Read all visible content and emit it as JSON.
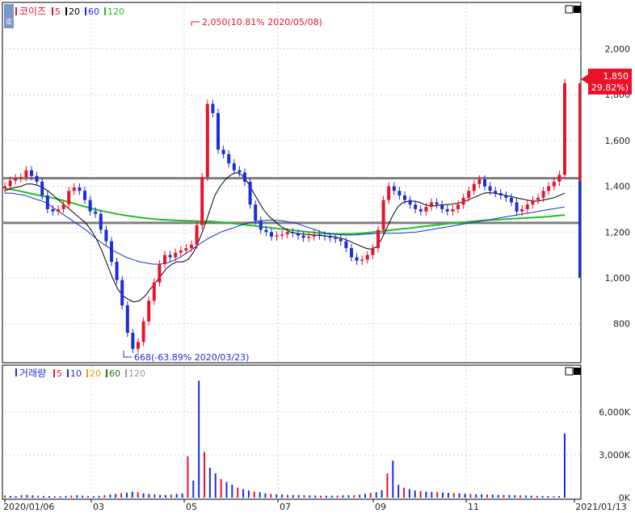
{
  "chart_data": [
    {
      "type": "candlestick",
      "title": "코이즈",
      "legend": [
        {
          "label": "5",
          "color": "#e8122a"
        },
        {
          "label": "20",
          "color": "#000000"
        },
        {
          "label": "60",
          "color": "#1a2fd6"
        },
        {
          "label": "120",
          "color": "#21c021"
        }
      ],
      "ylim": [
        640,
        2150
      ],
      "y_ticks": [
        "2,000",
        "1,800",
        "1,600",
        "1,400",
        "1,200",
        "1,000",
        "800"
      ],
      "y_tick_values": [
        2000,
        1800,
        1600,
        1400,
        1200,
        1000,
        800
      ],
      "x_tick_labels": [
        "2020/01/06",
        "03",
        "05",
        "07",
        "09",
        "11",
        "2021/01/13"
      ],
      "high_annotation": "2,050(10.81% 2020/05/08)",
      "low_annotation": "668(-63.89% 2020/03/23)",
      "current_price": "1,850",
      "current_change": "( 29.82%)",
      "horizontal_lines": [
        1435,
        1240
      ],
      "series": {
        "close": [
          1400,
          1425,
          1435,
          1440,
          1470,
          1445,
          1420,
          1360,
          1300,
          1290,
          1300,
          1320,
          1380,
          1395,
          1380,
          1340,
          1290,
          1280,
          1210,
          1160,
          1070,
          990,
          880,
          760,
          690,
          720,
          810,
          900,
          980,
          1060,
          1100,
          1090,
          1110,
          1120,
          1130,
          1145,
          1230,
          1440,
          1760,
          1720,
          1560,
          1540,
          1500,
          1470,
          1460,
          1420,
          1320,
          1250,
          1210,
          1200,
          1180,
          1185,
          1190,
          1200,
          1195,
          1185,
          1175,
          1180,
          1190,
          1185,
          1180,
          1175,
          1170,
          1160,
          1130,
          1090,
          1075,
          1080,
          1100,
          1130,
          1210,
          1340,
          1400,
          1380,
          1360,
          1340,
          1320,
          1300,
          1290,
          1310,
          1330,
          1320,
          1300,
          1290,
          1300,
          1320,
          1350,
          1380,
          1410,
          1430,
          1400,
          1380,
          1370,
          1360,
          1350,
          1330,
          1290,
          1300,
          1320,
          1340,
          1350,
          1380,
          1400,
          1420,
          1450,
          1850
        ],
        "ma20": [
          1380,
          1390,
          1395,
          1400,
          1410,
          1410,
          1405,
          1395,
          1380,
          1360,
          1340,
          1320,
          1300,
          1280,
          1260,
          1240,
          1210,
          1170,
          1120,
          1060,
          1000,
          950,
          920,
          905,
          895,
          900,
          920,
          950,
          980,
          1010,
          1040,
          1060,
          1070,
          1070,
          1080,
          1110,
          1160,
          1220,
          1290,
          1360,
          1400,
          1430,
          1450,
          1460,
          1450,
          1420,
          1380,
          1340,
          1300,
          1270,
          1250,
          1230,
          1215,
          1200,
          1195,
          1192,
          1190,
          1188,
          1186,
          1184,
          1182,
          1180,
          1175,
          1170,
          1160,
          1150,
          1140,
          1130,
          1125,
          1135,
          1170,
          1220,
          1270,
          1310,
          1330,
          1335,
          1335,
          1330,
          1320,
          1315,
          1315,
          1318,
          1320,
          1322,
          1325,
          1330,
          1340,
          1350,
          1360,
          1370,
          1372,
          1370,
          1365,
          1360,
          1355,
          1350,
          1345,
          1340,
          1335,
          1335,
          1340,
          1345,
          1350,
          1360,
          1370
        ],
        "ma60": [
          1370,
          1370,
          1365,
          1360,
          1350,
          1340,
          1330,
          1310,
          1290,
          1270,
          1250,
          1230,
          1210,
          1185,
          1160,
          1140,
          1120,
          1105,
          1090,
          1080,
          1070,
          1065,
          1060,
          1060,
          1065,
          1075,
          1090,
          1110,
          1130,
          1150,
          1170,
          1185,
          1200,
          1210,
          1220,
          1230,
          1240,
          1245,
          1250,
          1252,
          1252,
          1250,
          1245,
          1240,
          1230,
          1220,
          1210,
          1200,
          1192,
          1190,
          1188,
          1187,
          1188,
          1190,
          1192,
          1194,
          1195,
          1195,
          1195,
          1196,
          1198,
          1200,
          1205,
          1210,
          1215,
          1220,
          1225,
          1230,
          1235,
          1240,
          1245,
          1250,
          1255,
          1260,
          1265,
          1270,
          1275,
          1280,
          1285,
          1290,
          1295,
          1300,
          1305,
          1310
        ],
        "ma120": [
          1390,
          1385,
          1378,
          1370,
          1362,
          1355,
          1348,
          1340,
          1330,
          1320,
          1310,
          1300,
          1292,
          1285,
          1278,
          1272,
          1267,
          1262,
          1258,
          1255,
          1253,
          1251,
          1250,
          1249,
          1248,
          1247,
          1245,
          1242,
          1238,
          1234,
          1230,
          1226,
          1222,
          1218,
          1214,
          1210,
          1206,
          1202,
          1198,
          1195,
          1193,
          1192,
          1192,
          1193,
          1195,
          1198,
          1202,
          1206,
          1210,
          1214,
          1218,
          1222,
          1226,
          1230,
          1234,
          1238,
          1242,
          1245,
          1248,
          1251,
          1253,
          1255,
          1257,
          1259,
          1261,
          1263,
          1265,
          1268,
          1271,
          1275
        ]
      }
    },
    {
      "type": "bar",
      "title": "거래량",
      "legend": [
        {
          "label": "5",
          "color": "#e8122a"
        },
        {
          "label": "10",
          "color": "#1a2fd6"
        },
        {
          "label": "20",
          "color": "#e89b12"
        },
        {
          "label": "60",
          "color": "#1a7a1a"
        },
        {
          "label": "120",
          "color": "#999999"
        }
      ],
      "ylim": [
        0,
        8500
      ],
      "y_ticks": [
        "6,000K",
        "3,000K",
        "0K"
      ],
      "y_tick_values": [
        6000,
        3000,
        0
      ],
      "values": [
        150,
        120,
        110,
        180,
        200,
        160,
        140,
        120,
        110,
        100,
        90,
        120,
        150,
        170,
        140,
        110,
        100,
        120,
        180,
        220,
        260,
        300,
        350,
        420,
        380,
        300,
        260,
        240,
        200,
        180,
        220,
        260,
        300,
        2900,
        1200,
        8200,
        3200,
        2100,
        1700,
        1300,
        1100,
        900,
        700,
        600,
        500,
        420,
        380,
        300,
        260,
        240,
        220,
        200,
        190,
        180,
        170,
        160,
        150,
        140,
        130,
        140,
        150,
        160,
        170,
        180,
        200,
        260,
        320,
        380,
        520,
        1700,
        2600,
        900,
        700,
        600,
        500,
        460,
        420,
        400,
        380,
        360,
        340,
        320,
        300,
        280,
        260,
        240,
        230,
        220,
        210,
        200,
        190,
        180,
        170,
        160,
        150,
        140,
        130,
        120,
        110,
        100,
        110,
        4500
      ]
    }
  ]
}
